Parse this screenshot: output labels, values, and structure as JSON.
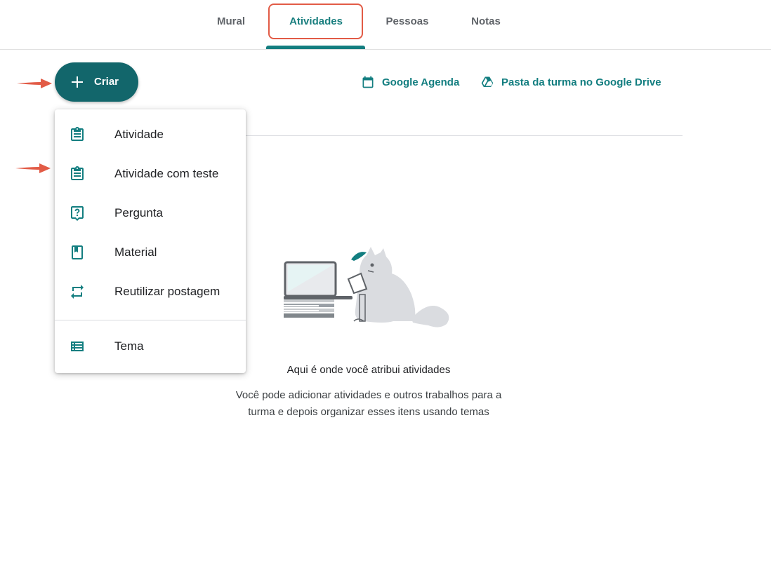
{
  "tabs": [
    {
      "label": "Mural",
      "active": false
    },
    {
      "label": "Atividades",
      "active": true
    },
    {
      "label": "Pessoas",
      "active": false
    },
    {
      "label": "Notas",
      "active": false
    }
  ],
  "create_button": {
    "label": "Criar",
    "icon": "plus-icon"
  },
  "links": {
    "agenda": {
      "label": "Google Agenda",
      "icon": "calendar-icon"
    },
    "drive": {
      "label": "Pasta da turma no Google Drive",
      "icon": "drive-icon"
    }
  },
  "menu": {
    "items": [
      {
        "label": "Atividade",
        "icon": "assignment-icon"
      },
      {
        "label": "Atividade com teste",
        "icon": "quiz-assignment-icon"
      },
      {
        "label": "Pergunta",
        "icon": "question-icon"
      },
      {
        "label": "Material",
        "icon": "material-icon"
      },
      {
        "label": "Reutilizar postagem",
        "icon": "reuse-icon"
      }
    ],
    "topic": {
      "label": "Tema",
      "icon": "topic-icon"
    }
  },
  "empty_state": {
    "title": "Aqui é onde você atribui atividades",
    "description": "Você pode adicionar atividades e outros trabalhos para a turma e depois organizar esses itens usando temas"
  },
  "colors": {
    "accent": "#137e80",
    "create_button": "#12666b",
    "highlight": "#e25b46"
  }
}
